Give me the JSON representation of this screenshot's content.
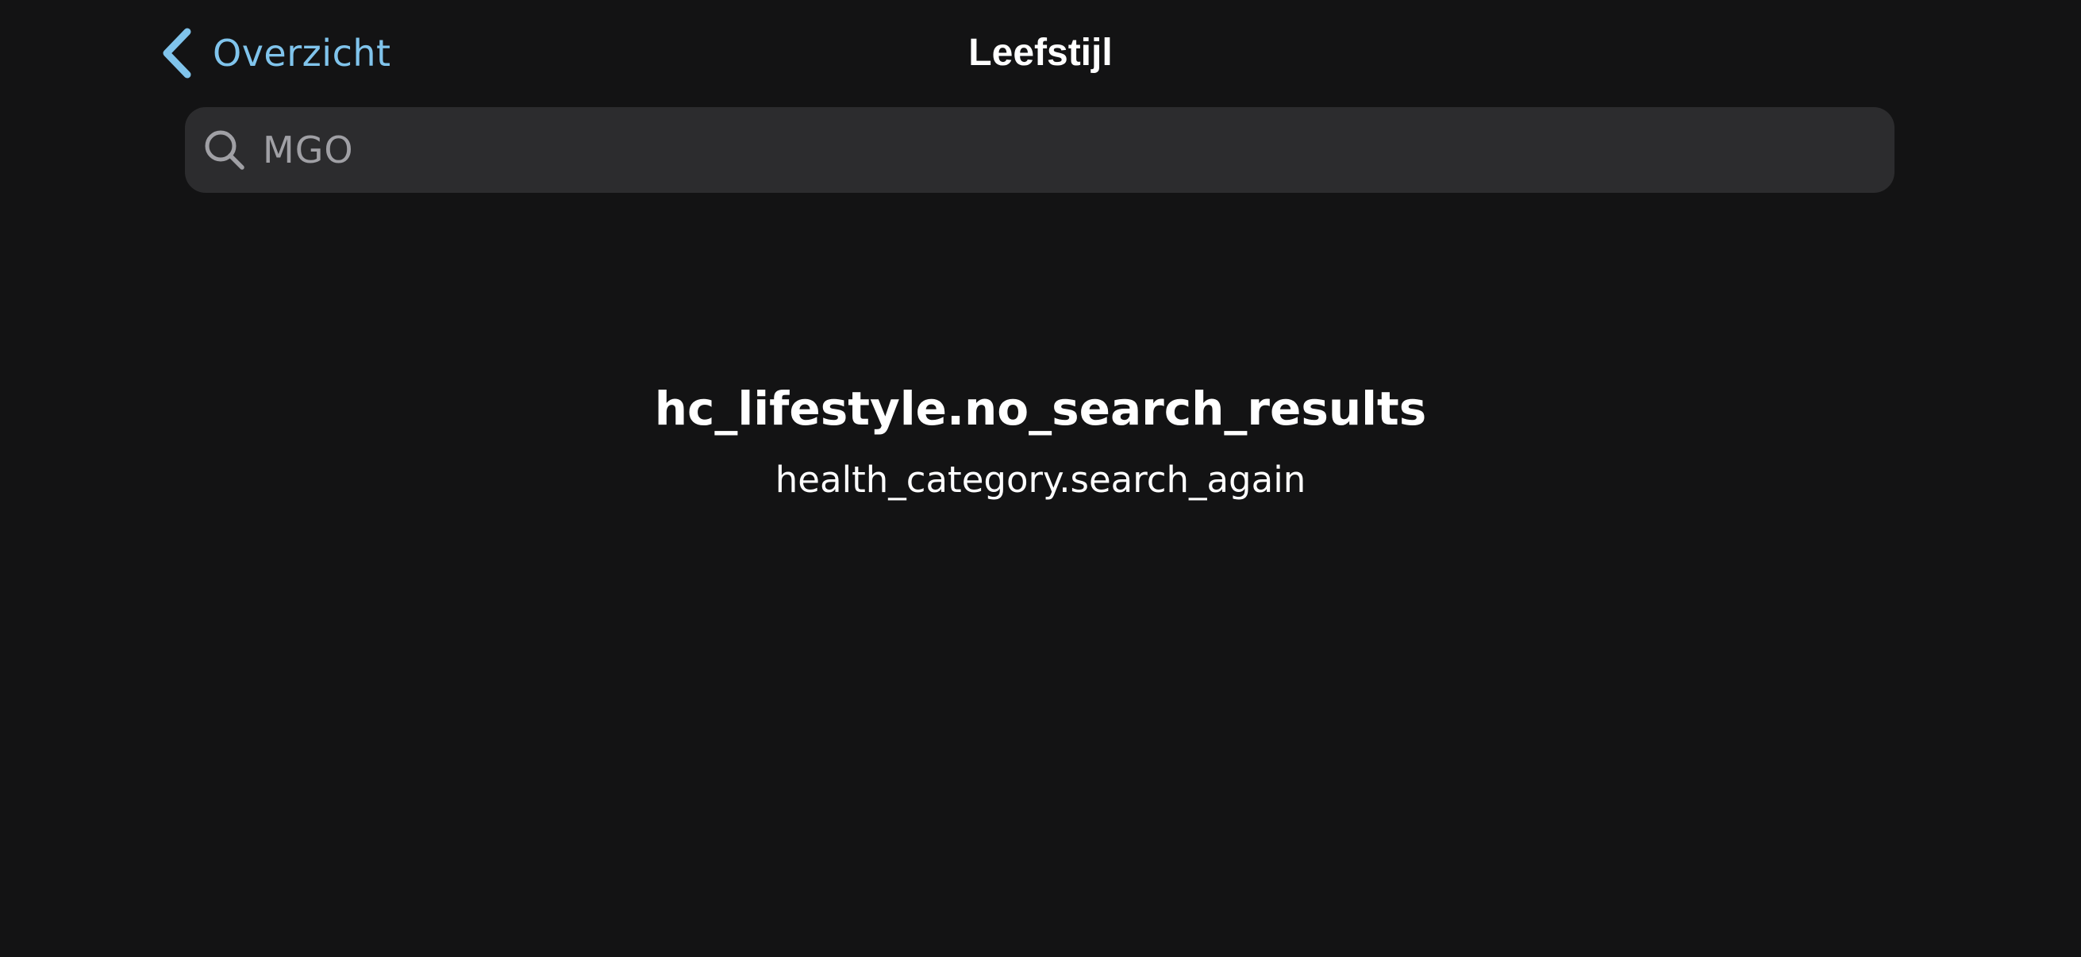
{
  "nav": {
    "back_label": "Overzicht",
    "title": "Leefstijl"
  },
  "search": {
    "value": "MGO",
    "icon": "search-icon"
  },
  "empty_state": {
    "title": "hc_lifestyle.no_search_results",
    "subtitle": "health_category.search_again"
  },
  "colors": {
    "background": "#131314",
    "accent": "#80c4ec",
    "search_field": "#2c2c2e",
    "search_text": "#a0a0a5",
    "text": "#ffffff"
  }
}
